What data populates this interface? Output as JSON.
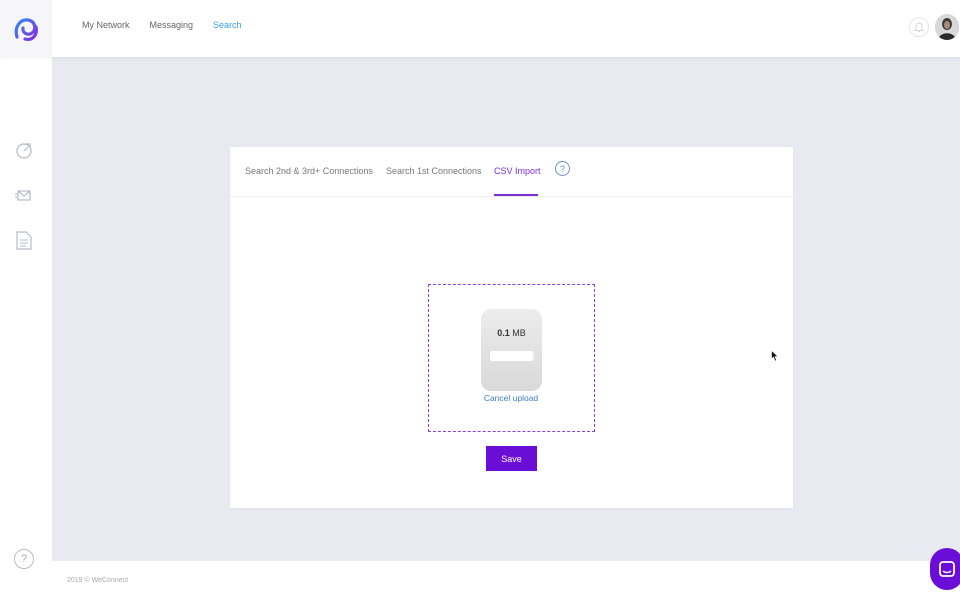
{
  "nav": {
    "items": [
      {
        "label": "My Network",
        "active": false
      },
      {
        "label": "Messaging",
        "active": false
      },
      {
        "label": "Search",
        "active": true
      }
    ]
  },
  "tabs": [
    {
      "label": "Search 2nd & 3rd+ Connections",
      "active": false
    },
    {
      "label": "Search 1st Connections",
      "active": false
    },
    {
      "label": "CSV Import",
      "active": true
    }
  ],
  "upload": {
    "size_value": "0.1",
    "size_unit": "MB",
    "progress": 0.95,
    "cancel_label": "Cancel upload"
  },
  "save_label": "Save",
  "sidebar": {
    "icons": [
      "dashboard-icon",
      "campaign-icon",
      "document-icon"
    ],
    "help": "?"
  },
  "tab_help": "?",
  "footer": {
    "copyright": "2019 © WeConnect"
  },
  "colors": {
    "accent": "#6a0dd6",
    "tab_active": "#7b2fd6",
    "link": "#3aa0e6",
    "background": "#e9e9f1"
  }
}
